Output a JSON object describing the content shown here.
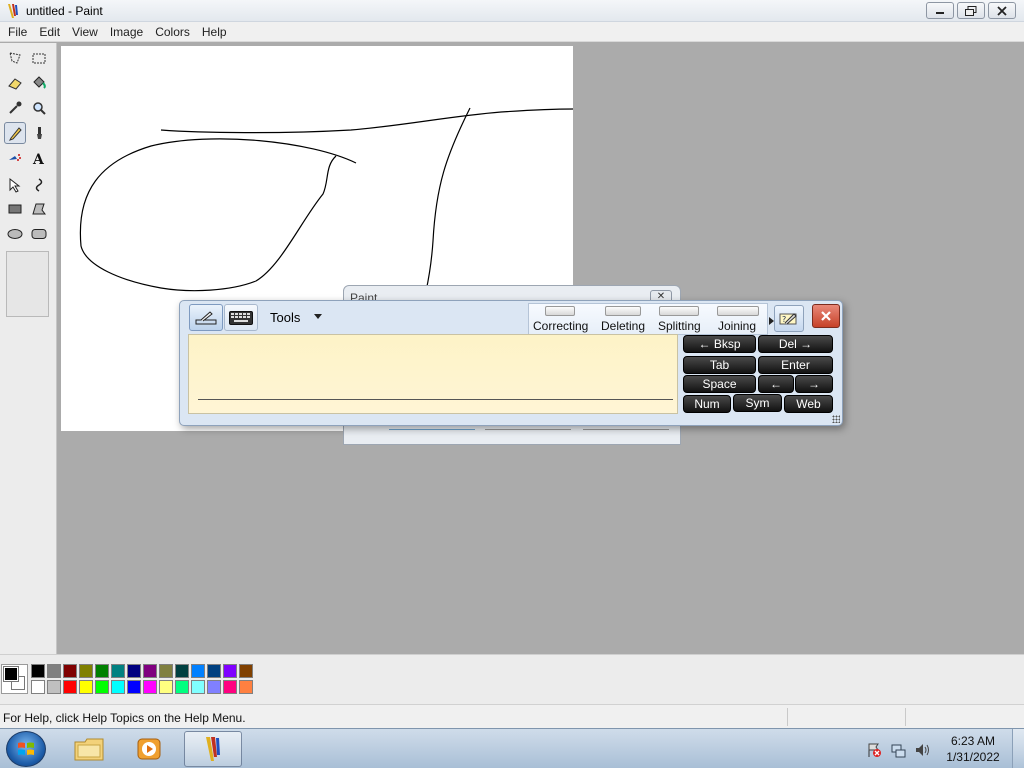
{
  "window": {
    "title": "untitled - Paint"
  },
  "menu": {
    "items": [
      "File",
      "Edit",
      "View",
      "Image",
      "Colors",
      "Help"
    ]
  },
  "tools": [
    {
      "name": "free-form-select-icon"
    },
    {
      "name": "rectangle-select-icon"
    },
    {
      "name": "eraser-icon"
    },
    {
      "name": "fill-bucket-icon"
    },
    {
      "name": "color-picker-icon"
    },
    {
      "name": "magnifier-icon"
    },
    {
      "name": "pencil-icon",
      "active": true
    },
    {
      "name": "brush-icon"
    },
    {
      "name": "airbrush-icon"
    },
    {
      "name": "text-icon"
    },
    {
      "name": "line-icon"
    },
    {
      "name": "curve-icon"
    },
    {
      "name": "rectangle-icon"
    },
    {
      "name": "polygon-icon"
    },
    {
      "name": "ellipse-icon"
    },
    {
      "name": "rounded-rectangle-icon"
    }
  ],
  "background_dialog": {
    "title": "Paint"
  },
  "input_panel": {
    "tools_label": "Tools",
    "gestures": {
      "correcting": "Correcting",
      "deleting": "Deleting",
      "splitting": "Splitting",
      "joining": "Joining"
    },
    "keys": {
      "bksp": "← Bksp",
      "del": "Del →",
      "tab": "Tab",
      "enter": "Enter",
      "space": "Space",
      "left": "←",
      "right": "→",
      "num": "Num",
      "sym": "Sym",
      "web": "Web"
    }
  },
  "palette": {
    "foreground": "#000000",
    "background": "#ffffff",
    "row1": [
      "#000000",
      "#808080",
      "#800000",
      "#808000",
      "#008000",
      "#008080",
      "#000080",
      "#800080",
      "#808040",
      "#004040",
      "#0080ff",
      "#004080",
      "#8000ff",
      "#804000"
    ],
    "row2": [
      "#ffffff",
      "#c0c0c0",
      "#ff0000",
      "#ffff00",
      "#00ff00",
      "#00ffff",
      "#0000ff",
      "#ff00ff",
      "#ffff80",
      "#00ff80",
      "#80ffff",
      "#8080ff",
      "#ff0080",
      "#ff8040"
    ]
  },
  "status": {
    "help_text": "For Help, click Help Topics on the Help Menu."
  },
  "taskbar": {
    "time": "6:23 AM",
    "date": "1/31/2022"
  }
}
